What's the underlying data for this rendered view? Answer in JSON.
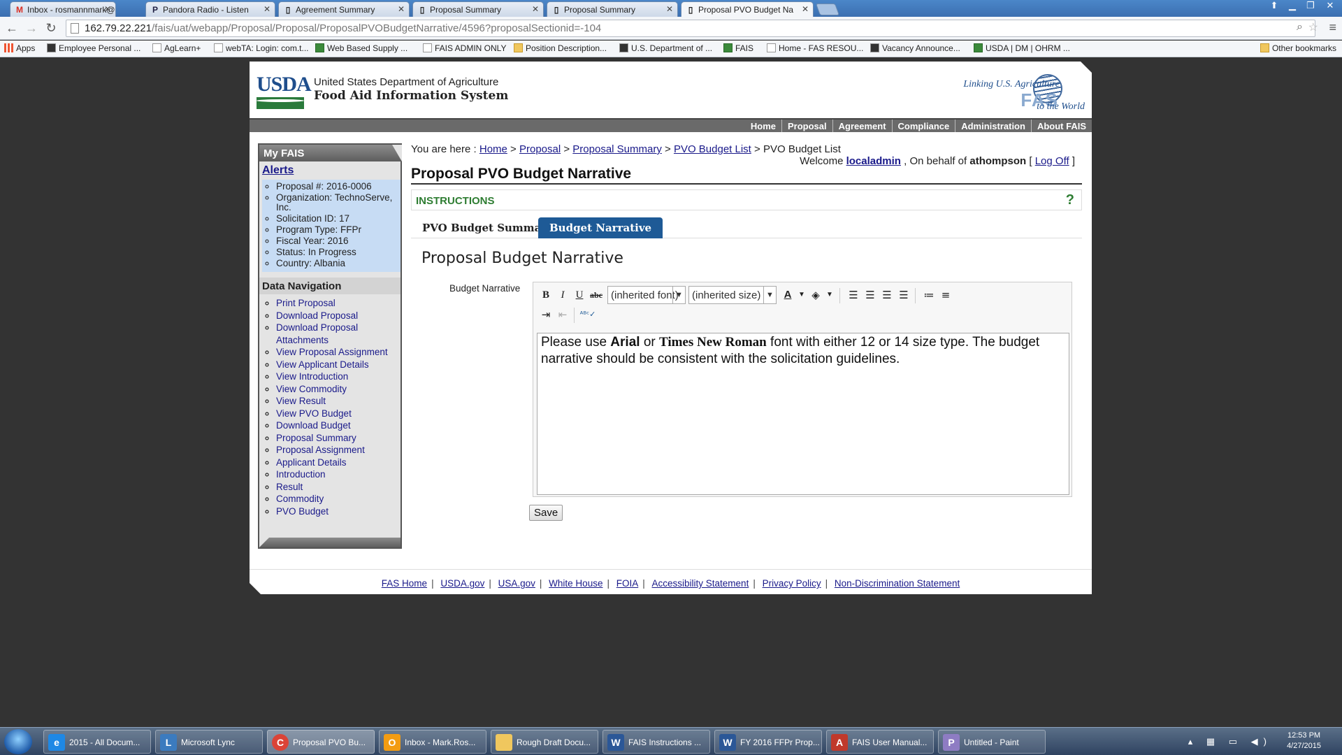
{
  "browser": {
    "tabs": [
      {
        "label": "Inbox - rosmannmark@g",
        "icon": "M"
      },
      {
        "label": "Pandora Radio - Listen",
        "icon": "P"
      },
      {
        "label": "Agreement Summary",
        "icon": ""
      },
      {
        "label": "Proposal Summary",
        "icon": ""
      },
      {
        "label": "Proposal Summary",
        "icon": ""
      },
      {
        "label": "Proposal PVO Budget Na",
        "icon": ""
      }
    ],
    "url_host": "162.79.22.221",
    "url_path": "/fais/uat/webapp/Proposal/Proposal/ProposalPVOBudgetNarrative/4596?proposalSectionid=-104",
    "bookmarks": [
      "Apps",
      "Employee Personal ...",
      "AgLearn+",
      "webTA: Login: com.t...",
      "Web Based Supply ...",
      "FAIS ADMIN ONLY",
      "Position Description...",
      "U.S. Department of ...",
      "FAIS",
      "Home - FAS RESOU...",
      "Vacancy Announce...",
      "USDA | DM | OHRM ..."
    ],
    "other_bookmarks": "Other bookmarks"
  },
  "header": {
    "logo_text": "USDA",
    "department": "United States Department of Agriculture",
    "system_name": "Food Aid Information System",
    "tagline_top": "Linking U.S. Agriculture",
    "tagline_logo": "FAS",
    "tagline_bottom": "to the World"
  },
  "mainnav": [
    "Home",
    "Proposal",
    "Agreement",
    "Compliance",
    "Administration",
    "About FAIS"
  ],
  "sidebar": {
    "title": "My FAIS",
    "alerts_title": "Alerts",
    "alerts": [
      "Proposal #: 2016-0006",
      "Organization: TechnoServe, Inc.",
      "Solicitation ID: 17",
      "Program Type: FFPr",
      "Fiscal Year: 2016",
      "Status: In Progress",
      "Country: Albania"
    ],
    "data_nav_title": "Data Navigation",
    "links": [
      "Print Proposal",
      "Download Proposal",
      "Download Proposal Attachments",
      "View Proposal Assignment",
      "View Applicant Details",
      "View Introduction",
      "View Commodity",
      "View Result",
      "View PVO Budget",
      "Download Budget",
      "Proposal Summary",
      "Proposal Assignment",
      "Applicant Details",
      "Introduction",
      "Result",
      "Commodity",
      "PVO Budget"
    ]
  },
  "breadcrumb": {
    "prefix": "You are here :",
    "items": [
      "Home",
      "Proposal",
      "Proposal Summary",
      "PVO Budget List"
    ],
    "current": "PVO Budget List"
  },
  "welcome": {
    "prefix": "Welcome",
    "user": "localadmin",
    "behalf_prefix": ", On behalf of",
    "behalf_user": "athompson",
    "logoff": "Log Off"
  },
  "page_title": "Proposal PVO Budget Narrative",
  "instructions_label": "INSTRUCTIONS",
  "help_glyph": "?",
  "tabs": [
    "PVO Budget Summary",
    "Budget Narrative"
  ],
  "active_tab": "Budget Narrative",
  "section_title": "Proposal Budget Narrative",
  "editor": {
    "field_label": "Budget Narrative",
    "font_select": "(inherited font)",
    "size_select": "(inherited size)",
    "text_before": "Please use ",
    "font1": "Arial",
    "text_mid": " or ",
    "font2": "Times New Roman",
    "text_after": " font with either 12 or 14 size type. The budget narrative should be consistent with the solicitation guidelines."
  },
  "save_label": "Save",
  "footer_links": [
    "FAS Home",
    "USDA.gov",
    "USA.gov",
    "White House",
    "FOIA",
    "Accessibility Statement",
    "Privacy Policy",
    "Non-Discrimination Statement"
  ],
  "taskbar": {
    "items": [
      {
        "label": "2015 - All Docum...",
        "icon": "e"
      },
      {
        "label": "Microsoft Lync",
        "icon": "L"
      },
      {
        "label": "Proposal PVO Bu...",
        "icon": "C"
      },
      {
        "label": "Inbox - Mark.Ros...",
        "icon": "O"
      },
      {
        "label": "Rough Draft Docu...",
        "icon": ""
      },
      {
        "label": "FAIS Instructions ...",
        "icon": "W"
      },
      {
        "label": "FY 2016 FFPr Prop...",
        "icon": "W"
      },
      {
        "label": "FAIS User Manual...",
        "icon": "A"
      },
      {
        "label": "Untitled - Paint",
        "icon": "P"
      }
    ],
    "time": "12:53 PM",
    "date": "4/27/2015"
  },
  "colors": {
    "nav_bar": "#6a6a6a",
    "active_tab": "#1e5a96",
    "alerts_bg": "#c7dcf4",
    "instructions_text": "#2e7d32"
  }
}
